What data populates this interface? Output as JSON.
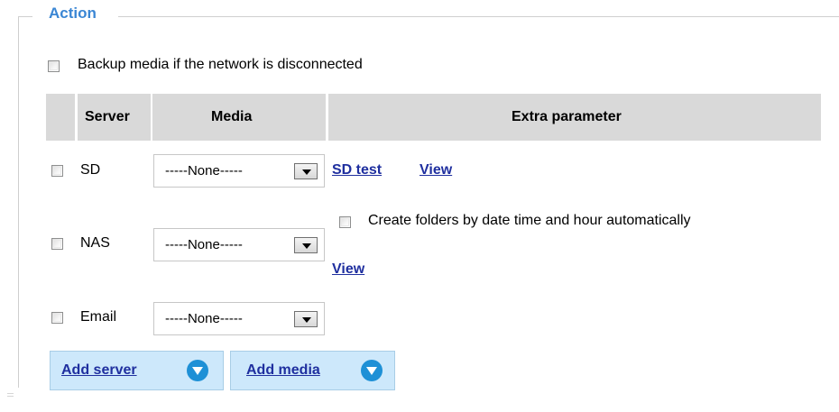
{
  "section": {
    "legend": "Action"
  },
  "backup": {
    "label": "Backup media if the network is disconnected"
  },
  "table": {
    "headers": {
      "server": "Server",
      "media": "Media",
      "extra": "Extra parameter"
    },
    "rows": {
      "sd": {
        "server": "SD",
        "media": "-----None-----",
        "link_test": "SD test",
        "link_view": "View"
      },
      "nas": {
        "server": "NAS",
        "media": "-----None-----",
        "folder_label": "Create folders by date time and hour automatically",
        "link_view": "View"
      },
      "email": {
        "server": "Email",
        "media": "-----None-----"
      }
    }
  },
  "buttons": {
    "add_server": "Add server",
    "add_media": "Add media"
  }
}
